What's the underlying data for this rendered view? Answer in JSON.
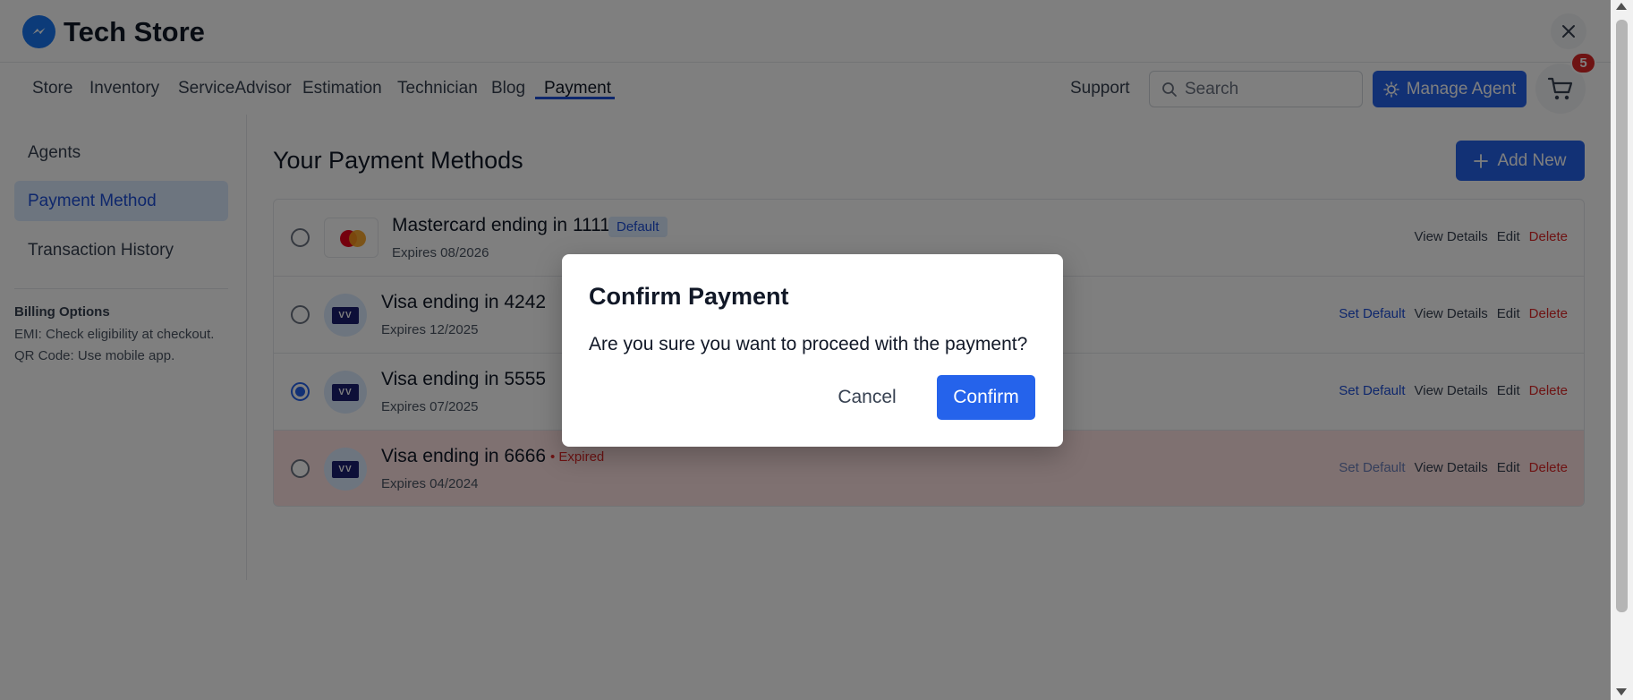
{
  "app": {
    "title": "Tech Store",
    "logo_icon": "messenger-icon",
    "accent": "#2563eb"
  },
  "nav": {
    "items": [
      "Store",
      "Inventory",
      "ServiceAdvisor",
      "Estimation",
      "Technician",
      "Blog",
      "Payment"
    ],
    "active": "Payment",
    "support_label": "Support",
    "search_placeholder": "Search",
    "manage_agent_label": "Manage Agent",
    "cart_count": "5"
  },
  "sidebar": {
    "items": [
      "Agents",
      "Payment Method",
      "Transaction History"
    ],
    "active": "Payment Method",
    "billing_title": "Billing Options",
    "billing_lines": [
      "EMI: Check eligibility at checkout.",
      "QR Code: Use mobile app."
    ]
  },
  "main": {
    "title": "Your Payment Methods",
    "add_new_label": "Add New",
    "methods": [
      {
        "name": "Mastercard ending in 1111",
        "expires": "Expires 08/2026",
        "badge": "Default",
        "brand": "mastercard",
        "selected": false,
        "actions": [
          "View Details",
          "Edit",
          "Delete"
        ]
      },
      {
        "name": "Visa ending in 4242",
        "expires": "Expires 12/2025",
        "brand": "visa",
        "selected": false,
        "actions": [
          "Set Default",
          "View Details",
          "Edit",
          "Delete"
        ]
      },
      {
        "name": "Visa ending in 5555",
        "expires": "Expires 07/2025",
        "brand": "visa",
        "selected": true,
        "actions": [
          "Set Default",
          "View Details",
          "Edit",
          "Delete"
        ]
      },
      {
        "name": "Visa ending in 6666",
        "expires": "Expires 04/2024",
        "status": "• Expired",
        "brand": "visa",
        "selected": false,
        "actions": [
          "Set Default",
          "View Details",
          "Edit",
          "Delete"
        ]
      }
    ]
  },
  "modal": {
    "title": "Confirm Payment",
    "message": "Are you sure you want to proceed with the payment?",
    "cancel_label": "Cancel",
    "confirm_label": "Confirm"
  }
}
